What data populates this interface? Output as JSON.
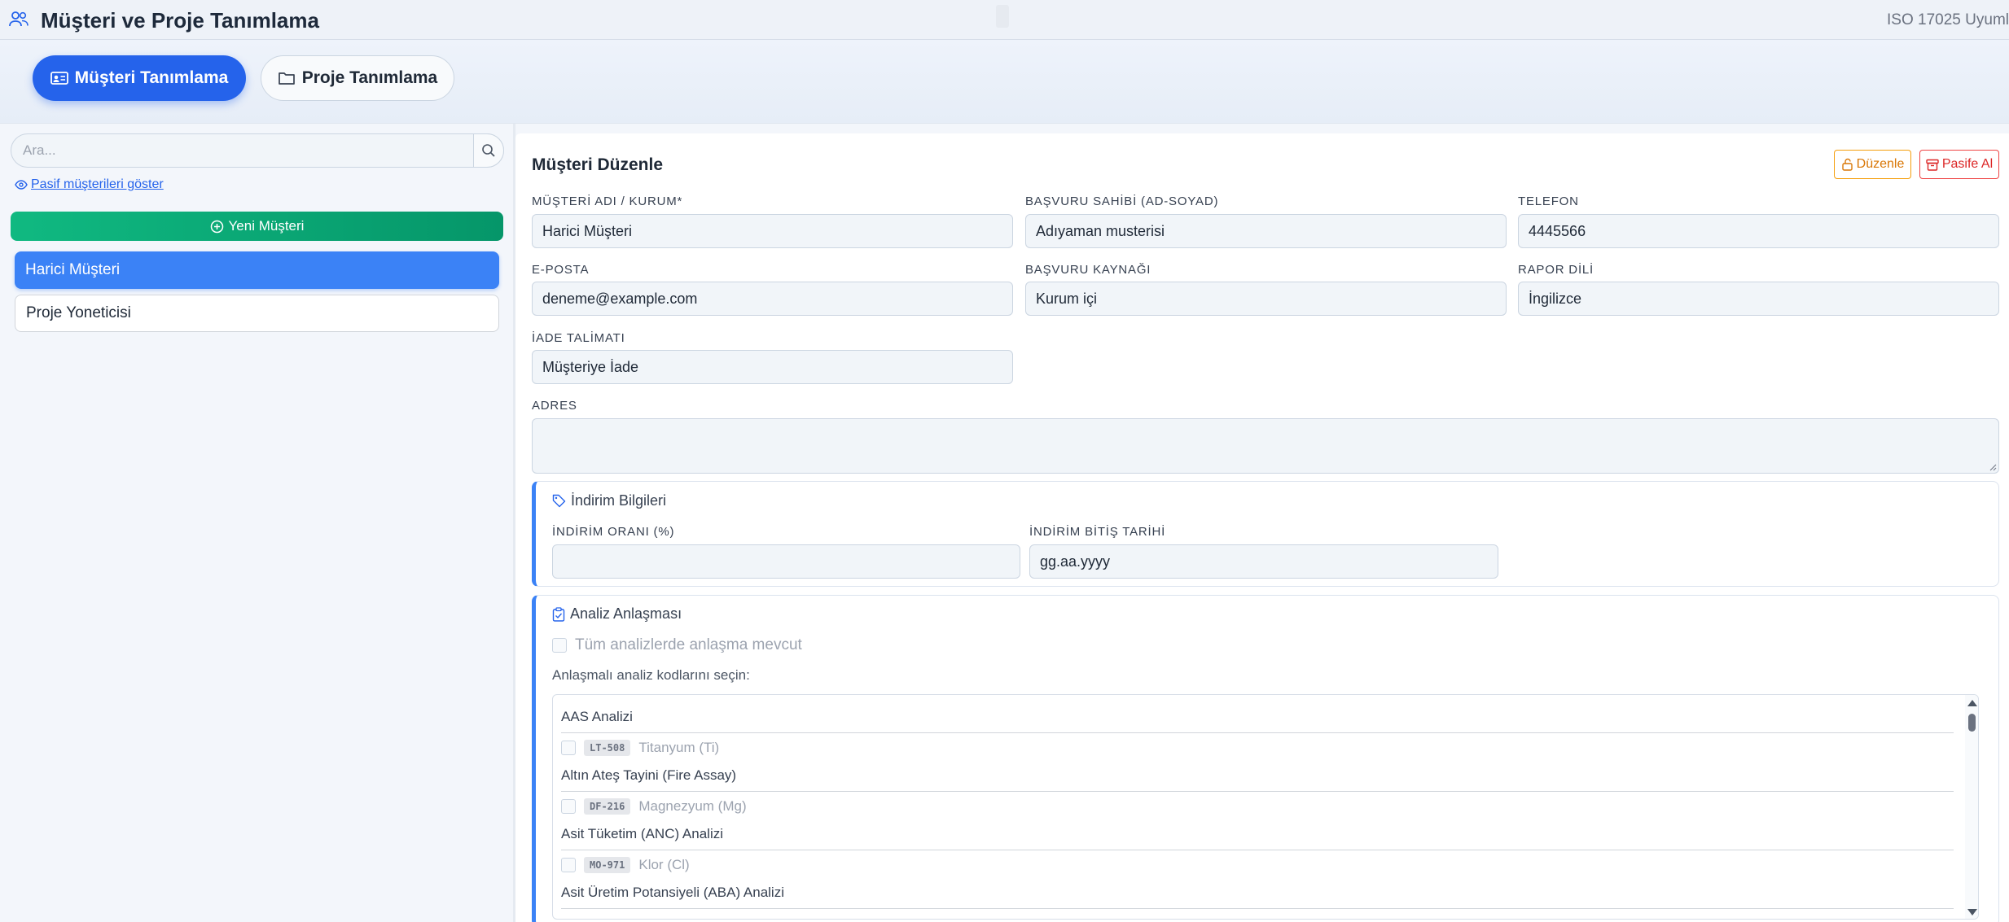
{
  "header": {
    "title": "Müşteri ve Proje Tanımlama",
    "iso": "ISO 17025 Uyuml"
  },
  "tabs": [
    {
      "label": "Müşteri Tanımlama",
      "active": true
    },
    {
      "label": "Proje Tanımlama",
      "active": false
    }
  ],
  "sidebar": {
    "search_placeholder": "Ara...",
    "show_passive": "Pasif müşterileri göster",
    "new_customer": "Yeni Müşteri",
    "customers": [
      "Harici Müşteri",
      "Proje Yoneticisi"
    ]
  },
  "form": {
    "title": "Müşteri Düzenle",
    "edit_button": "Düzenle",
    "passive_button": "Pasife Al",
    "fields": {
      "customer_name": {
        "label": "MÜŞTERİ ADI / KURUM*",
        "value": "Harici Müşteri"
      },
      "applicant": {
        "label": "BAŞVURU SAHİBİ (AD-SOYAD)",
        "value": "Adıyaman musterisi"
      },
      "phone": {
        "label": "TELEFON",
        "value": "4445566"
      },
      "email": {
        "label": "E-POSTA",
        "value": "deneme@example.com"
      },
      "source": {
        "label": "BAŞVURU KAYNAĞI",
        "value": "Kurum içi"
      },
      "report_lang": {
        "label": "RAPOR DİLİ",
        "value": "İngilizce"
      },
      "return": {
        "label": "İADE TALİMATI",
        "value": "Müşteriye İade"
      },
      "address": {
        "label": "ADRES",
        "value": ""
      }
    },
    "discount": {
      "title": "İndirim Bilgileri",
      "rate_label": "İNDİRİM ORANI (%)",
      "rate_value": "",
      "end_label": "İNDİRİM BİTİŞ TARİHİ",
      "end_value": "gg.aa.yyyy"
    },
    "agreement": {
      "title": "Analiz Anlaşması",
      "all_label": "Tüm analizlerde anlaşma mevcut",
      "select_label": "Anlaşmalı analiz kodlarını seçin:",
      "groups": [
        {
          "group": "AAS Analizi",
          "code": "LT-508",
          "item": "Titanyum (Ti)"
        },
        {
          "group": "Altın Ateş Tayini (Fire Assay)",
          "code": "DF-216",
          "item": "Magnezyum (Mg)"
        },
        {
          "group": "Asit Tüketim (ANC) Analizi",
          "code": "MO-971",
          "item": "Klor (Cl)"
        },
        {
          "group": "Asit Üretim Potansiyeli (ABA) Analizi",
          "code": "",
          "item": ""
        }
      ]
    }
  },
  "colors": {
    "primary": "#2563eb",
    "success": "#10b981",
    "warning": "#d97706",
    "danger": "#dc2626"
  }
}
